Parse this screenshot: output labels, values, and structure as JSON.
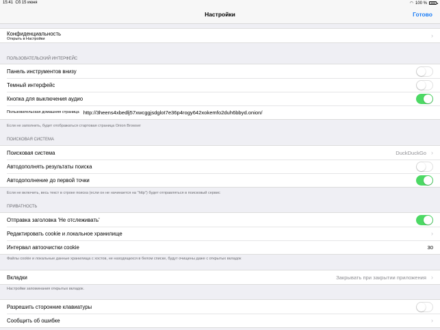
{
  "status": {
    "time": "15:41",
    "date": "Сб 15 июня",
    "battery": "100 %"
  },
  "nav": {
    "title": "Настройки",
    "done": "Готово"
  },
  "privacy_top": {
    "label": "Конфиденциальность",
    "sub": "Открыть в Настройки"
  },
  "ui_section": {
    "header": "ПОЛЬЗОВАТЕЛЬСКИЙ ИНТЕРФЕЙС",
    "toolbar_bottom": "Панель инструментов внизу",
    "dark_ui": "Темный интерфейс",
    "mute_button": "Кнопка для выключения аудио",
    "homepage_label": "Пользовательская домашняя страница",
    "homepage_value": "http://3heens4xbedlj57xwcggjsdglot7e36p4rogy642xokemfo2duh6bbyd.onion/",
    "footer": "Если не заполнить, будет отображаться стартовая страница Onion Browser"
  },
  "search_section": {
    "header": "ПОИСКОВАЯ СИСТЕМА",
    "engine_label": "Поисковая система",
    "engine_value": "DuckDuckGo",
    "autocomplete": "Автодополнять результаты поиска",
    "autocomplete_dot": "Автодополнение до первой точки",
    "footer": "Если не включить, весь текст в строке поиска (если он не начинается на \"http\") будет отправляться в поисковый сервис"
  },
  "privacy_section": {
    "header": "ПРИВАТНОСТЬ",
    "dnt": "Отправка заголовка 'Не отслеживать'",
    "edit_cookies": "Редактировать cookie и локальное хранилище",
    "cookie_interval_label": "Интервал автоочистки cookie",
    "cookie_interval_value": "30",
    "footer": "Файлы cookie и локальные данные хранилища с хостов, не находящихся в белом списке, будут очищены даже с открытых вкладок"
  },
  "tabs_section": {
    "label": "Вкладки",
    "value": "Закрывать при закрытии приложения",
    "footer": "Настройки запоминания открытых вкладок."
  },
  "misc_section": {
    "third_party_keyboards": "Разрешить сторонние клавиатуры",
    "report_bug": "Сообщить об ошибке"
  },
  "toggles": {
    "toolbar_bottom": false,
    "dark_ui": false,
    "mute_button": true,
    "autocomplete": false,
    "autocomplete_dot": true,
    "dnt": true,
    "third_party_keyboards": false
  }
}
